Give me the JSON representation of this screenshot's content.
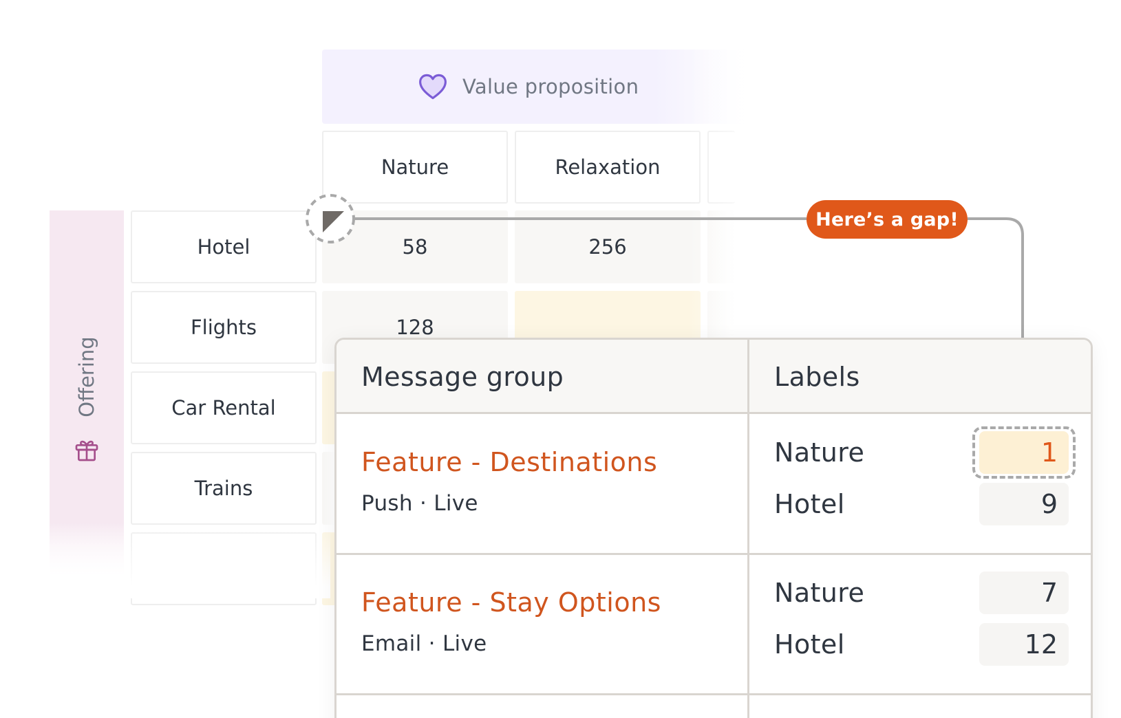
{
  "matrix": {
    "column_group_label": "Value proposition",
    "column_headers": [
      "Nature",
      "Relaxation"
    ],
    "row_group_label": "Offering",
    "row_headers": [
      "Hotel",
      "Flights",
      "Car Rental",
      "Trains"
    ],
    "cells": {
      "hotel_nature": "58",
      "hotel_relaxation": "256",
      "flights_nature": "128"
    }
  },
  "callout": {
    "label": "Here’s a gap!"
  },
  "panel": {
    "headers": {
      "group": "Message group",
      "labels": "Labels"
    },
    "rows": [
      {
        "title": "Feature - Destinations",
        "meta": "Push · Live",
        "labels": [
          {
            "name": "Nature",
            "count": "1",
            "highlighted": true
          },
          {
            "name": "Hotel",
            "count": "9",
            "highlighted": false
          }
        ]
      },
      {
        "title": "Feature - Stay Options",
        "meta": "Email · Live",
        "labels": [
          {
            "name": "Nature",
            "count": "7",
            "highlighted": false
          },
          {
            "name": "Hotel",
            "count": "12",
            "highlighted": false
          }
        ]
      }
    ]
  },
  "colors": {
    "accent": "#e0581a",
    "gap_highlight": "#fdf0d4",
    "value_prop_bg": "#f4f1fe",
    "offering_bg": "#f6e8f1",
    "heart_icon": "#7b5cd6",
    "gift_icon": "#a54f8c"
  },
  "icons": {
    "value_proposition": "heart-icon",
    "offering": "gift-icon",
    "gap_marker": "corner-triangle-icon"
  }
}
